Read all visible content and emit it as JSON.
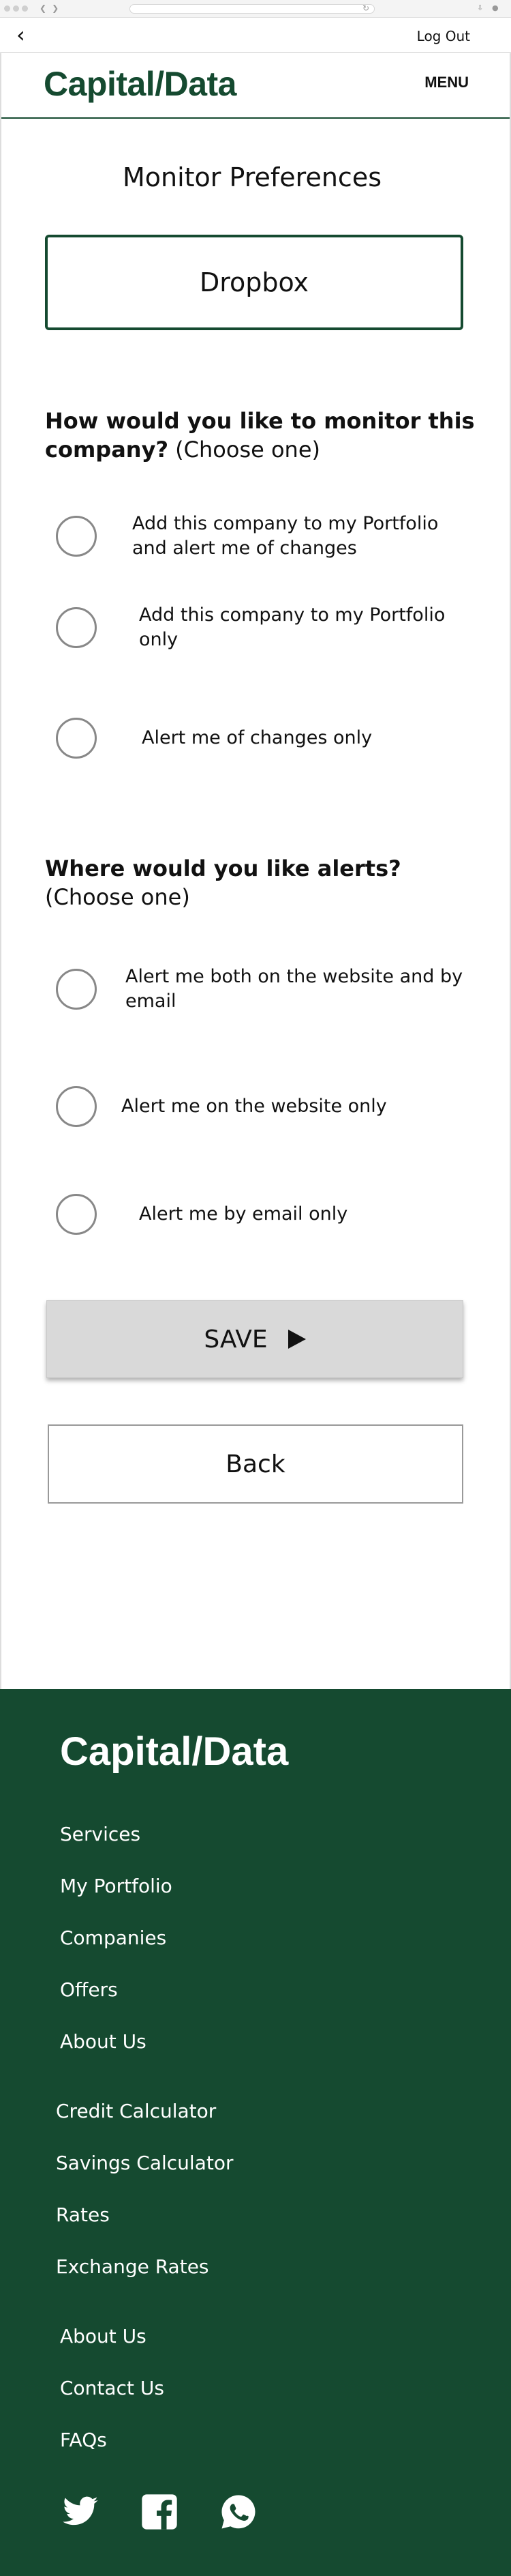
{
  "topbar": {
    "logout_label": "Log Out"
  },
  "header": {
    "brand": "Capital/Data",
    "menu_label": "MENU"
  },
  "main": {
    "title": "Monitor Preferences",
    "company_name": "Dropbox",
    "monitor_question": {
      "bold": "How would you like to monitor this company?",
      "hint": "(Choose one)"
    },
    "monitor_options": [
      "Add this company to my Portfolio and alert me of changes",
      "Add this company to my Portfolio only",
      "Alert me of changes only"
    ],
    "alerts_question": {
      "bold": "Where would you like alerts?",
      "hint": "(Choose one)"
    },
    "alert_options": [
      "Alert me both on the website and by email",
      "Alert me on the website only",
      "Alert me by email only"
    ],
    "save_label": "SAVE",
    "back_label": "Back"
  },
  "footer": {
    "brand": "Capital/Data",
    "links_group1": [
      "Services",
      "My Portfolio",
      "Companies",
      "Offers",
      "About Us"
    ],
    "links_group2": [
      "Credit Calculator",
      "Savings Calculator",
      "Rates",
      "Exchange Rates"
    ],
    "links_group3": [
      "About Us",
      "Contact Us",
      "FAQs"
    ],
    "social_icons": [
      "twitter-icon",
      "facebook-icon",
      "whatsapp-icon"
    ]
  },
  "colors": {
    "brand_green": "#154a30",
    "button_gray": "#d9d9d9"
  }
}
